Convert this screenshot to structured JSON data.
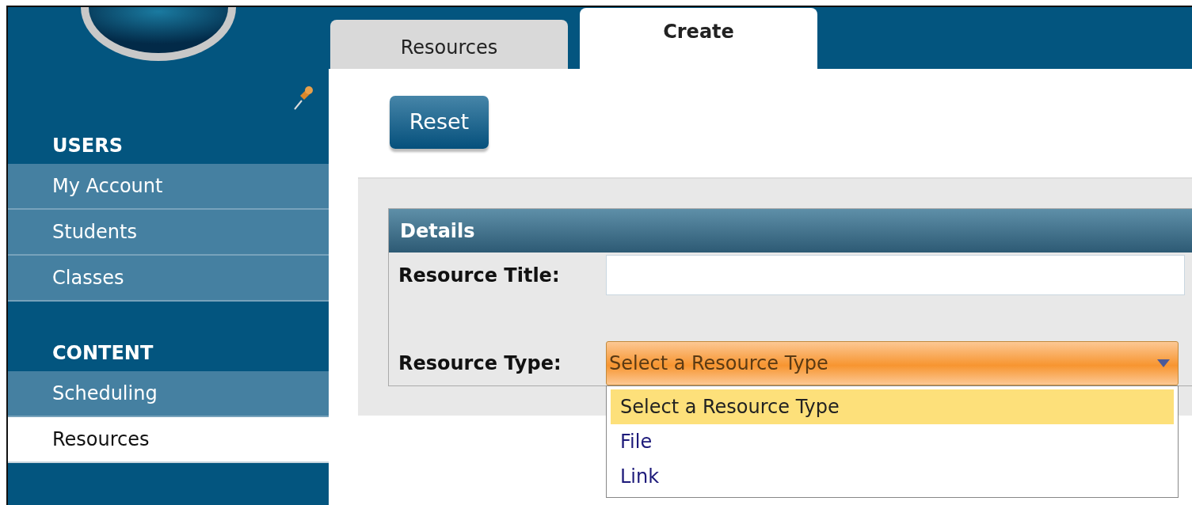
{
  "sidebar": {
    "sections": [
      {
        "heading": "USERS",
        "items": [
          {
            "label": "My Account",
            "selected": false
          },
          {
            "label": "Students",
            "selected": false
          },
          {
            "label": "Classes",
            "selected": false
          }
        ]
      },
      {
        "heading": "CONTENT",
        "items": [
          {
            "label": "Scheduling",
            "selected": false
          },
          {
            "label": "Resources",
            "selected": true
          }
        ]
      }
    ]
  },
  "tabs": [
    {
      "label": "Resources",
      "selected": false
    },
    {
      "label": "Create",
      "selected": true
    }
  ],
  "reset_button": "Reset",
  "details": {
    "title": "Details",
    "fields": [
      {
        "label": "Resource Title:",
        "kind": "text"
      },
      {
        "label": "Resource Type:",
        "kind": "select",
        "value": "Select a Resource Type",
        "expanded": true,
        "options": [
          {
            "label": "Select a Resource Type",
            "selected": true
          },
          {
            "label": "File",
            "selected": false
          },
          {
            "label": "Link",
            "selected": false
          }
        ]
      }
    ]
  }
}
